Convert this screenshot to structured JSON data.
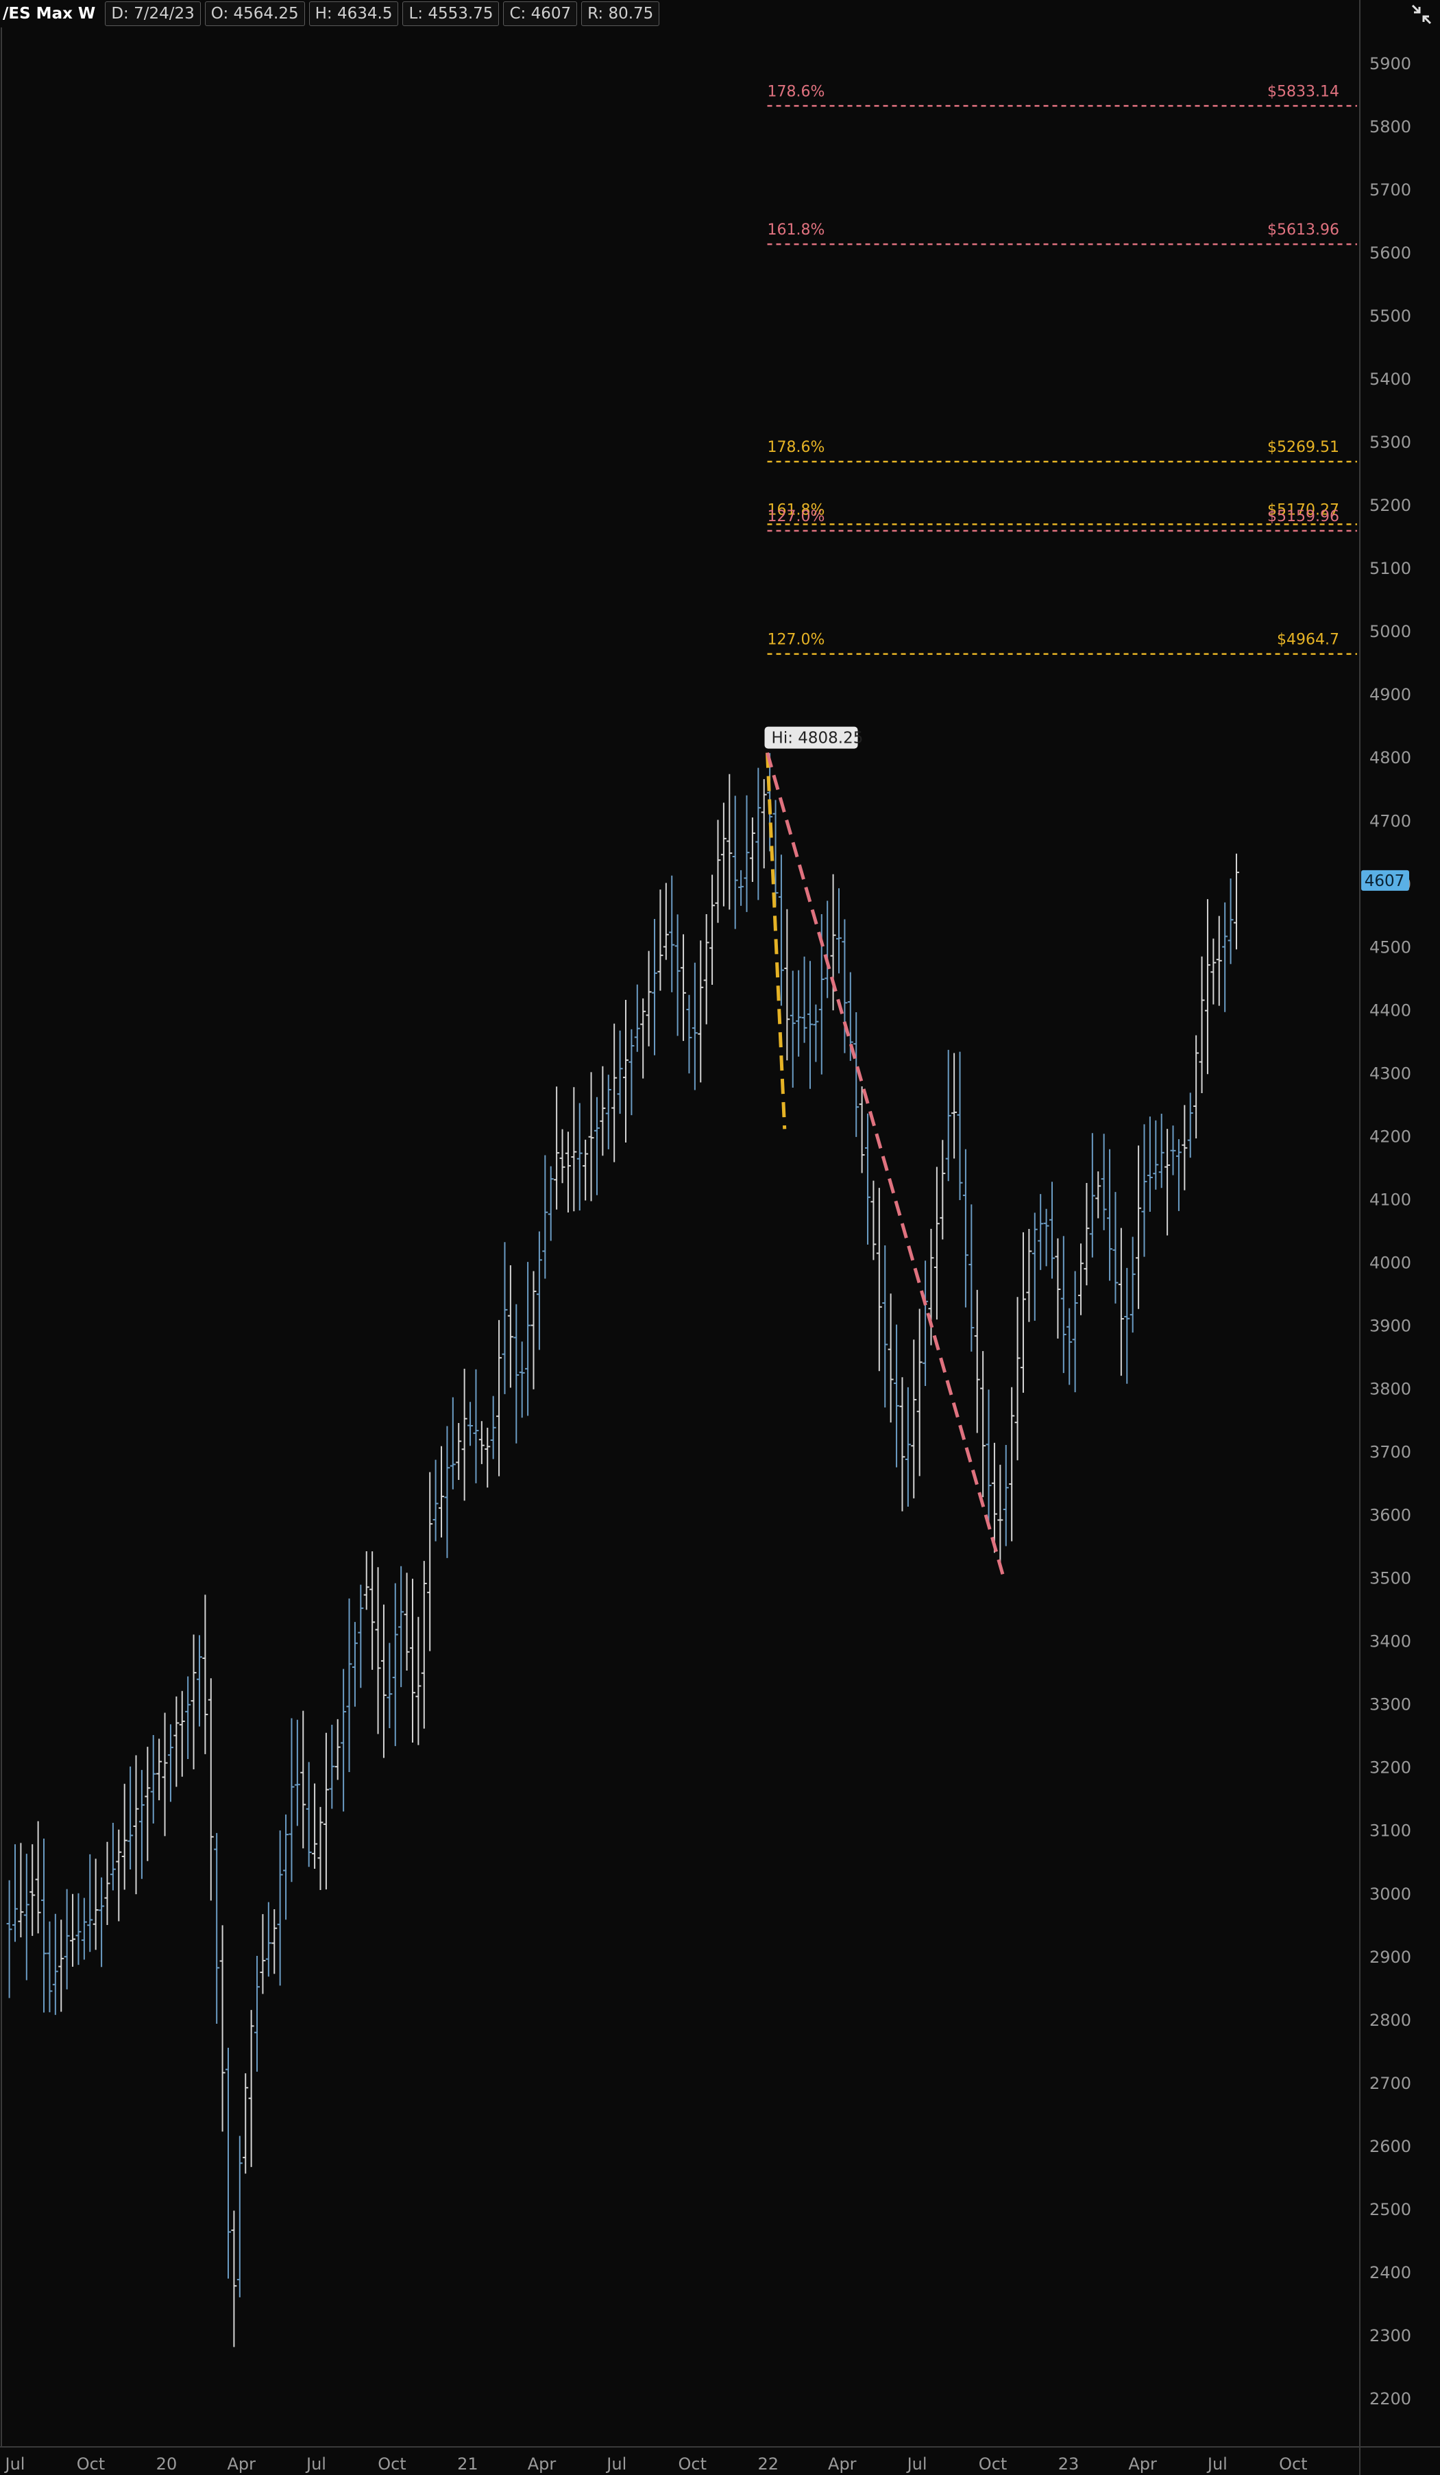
{
  "header": {
    "symbol": "/ES Max W",
    "date": "D: 7/24/23",
    "open": "O: 4564.25",
    "high": "H: 4634.5",
    "low": "L: 4553.75",
    "close": "C: 4607",
    "range": "R: 80.75"
  },
  "corner_icon": "collapse-arrows-icon",
  "colors": {
    "background": "#0a0a0a",
    "bar_light": "#d4d4d4",
    "bar_blue": "#6b9cc4",
    "fib_red": "#e0727f",
    "fib_gold": "#e6b325",
    "price_tag_bg": "#5ab0e6"
  },
  "chart_data": {
    "type": "ohlc",
    "title": "/ES Max W",
    "ylim": [
      2160,
      5980
    ],
    "y_ticks": [
      2200,
      2300,
      2400,
      2500,
      2600,
      2700,
      2800,
      2900,
      3000,
      3100,
      3200,
      3300,
      3400,
      3500,
      3600,
      3700,
      3800,
      3900,
      4000,
      4100,
      4200,
      4300,
      4400,
      4500,
      4600,
      4700,
      4800,
      4900,
      5000,
      5100,
      5200,
      5300,
      5400,
      5500,
      5600,
      5700,
      5800,
      5900
    ],
    "x_ticks": [
      {
        "label": "Jul",
        "date": "2019-07-01"
      },
      {
        "label": "Oct",
        "date": "2019-10-01"
      },
      {
        "label": "20",
        "date": "2020-01-01"
      },
      {
        "label": "Apr",
        "date": "2020-04-01"
      },
      {
        "label": "Jul",
        "date": "2020-07-01"
      },
      {
        "label": "Oct",
        "date": "2020-10-01"
      },
      {
        "label": "21",
        "date": "2021-01-01"
      },
      {
        "label": "Apr",
        "date": "2021-04-01"
      },
      {
        "label": "Jul",
        "date": "2021-07-01"
      },
      {
        "label": "Oct",
        "date": "2021-10-01"
      },
      {
        "label": "22",
        "date": "2022-01-01"
      },
      {
        "label": "Apr",
        "date": "2022-04-01"
      },
      {
        "label": "Jul",
        "date": "2022-07-01"
      },
      {
        "label": "Oct",
        "date": "2022-10-01"
      },
      {
        "label": "23",
        "date": "2023-01-01"
      },
      {
        "label": "Apr",
        "date": "2023-04-01"
      },
      {
        "label": "Jul",
        "date": "2023-07-01"
      },
      {
        "label": "Oct",
        "date": "2023-10-01"
      }
    ],
    "price_path": [
      [
        "2019-06-24",
        2950
      ],
      [
        "2019-07-26",
        3020
      ],
      [
        "2019-08-09",
        2850
      ],
      [
        "2019-08-30",
        2920
      ],
      [
        "2019-10-04",
        2960
      ],
      [
        "2019-11-01",
        3060
      ],
      [
        "2019-12-13",
        3170
      ],
      [
        "2020-01-24",
        3290
      ],
      [
        "2020-02-14",
        3390
      ],
      [
        "2020-02-28",
        2960
      ],
      [
        "2020-03-13",
        2640
      ],
      [
        "2020-03-20",
        2250
      ],
      [
        "2020-03-27",
        2540
      ],
      [
        "2020-04-17",
        2850
      ],
      [
        "2020-05-08",
        2930
      ],
      [
        "2020-06-05",
        3200
      ],
      [
        "2020-06-26",
        3050
      ],
      [
        "2020-07-31",
        3270
      ],
      [
        "2020-08-28",
        3500
      ],
      [
        "2020-09-25",
        3290
      ],
      [
        "2020-10-09",
        3470
      ],
      [
        "2020-10-30",
        3270
      ],
      [
        "2020-11-13",
        3580
      ],
      [
        "2020-12-31",
        3750
      ],
      [
        "2021-01-29",
        3700
      ],
      [
        "2021-02-12",
        3930
      ],
      [
        "2021-03-05",
        3810
      ],
      [
        "2021-04-16",
        4170
      ],
      [
        "2021-05-14",
        4160
      ],
      [
        "2021-06-25",
        4270
      ],
      [
        "2021-07-30",
        4390
      ],
      [
        "2021-08-27",
        4510
      ],
      [
        "2021-09-03",
        4530
      ],
      [
        "2021-10-01",
        4340
      ],
      [
        "2021-11-05",
        4690
      ],
      [
        "2021-11-26",
        4590
      ],
      [
        "2021-12-31",
        4770
      ],
      [
        "2022-01-21",
        4390
      ],
      [
        "2022-02-25",
        4380
      ],
      [
        "2022-03-25",
        4540
      ],
      [
        "2022-04-29",
        4130
      ],
      [
        "2022-05-20",
        3900
      ],
      [
        "2022-06-17",
        3670
      ],
      [
        "2022-07-29",
        4120
      ],
      [
        "2022-08-12",
        4290
      ],
      [
        "2022-09-02",
        3930
      ],
      [
        "2022-09-30",
        3590
      ],
      [
        "2022-10-14",
        3600
      ],
      [
        "2022-11-11",
        4000
      ],
      [
        "2022-12-02",
        4080
      ],
      [
        "2022-12-30",
        3860
      ],
      [
        "2023-02-03",
        4150
      ],
      [
        "2023-03-10",
        3870
      ],
      [
        "2023-03-31",
        4130
      ],
      [
        "2023-05-26",
        4200
      ],
      [
        "2023-06-16",
        4450
      ],
      [
        "2023-07-14",
        4520
      ],
      [
        "2023-07-24",
        4607
      ]
    ],
    "hi_label": "Hi: 4808.25",
    "hi_point": {
      "date": "2021-12-31",
      "price": 4808.25
    },
    "last_price_label": "4607",
    "last_price": 4607,
    "lines": [
      {
        "name": "gold",
        "from": {
          "date": "2021-12-31",
          "price": 4808.25
        },
        "to": {
          "date": "2022-01-21",
          "price": 4212
        }
      },
      {
        "name": "red",
        "from": {
          "date": "2021-12-31",
          "price": 4808.25
        },
        "to": {
          "date": "2022-10-14",
          "price": 3502
        }
      }
    ],
    "fib_levels": [
      {
        "pct_label": "178.6%",
        "price_label": "$5833.14",
        "price": 5833.14,
        "color": "red"
      },
      {
        "pct_label": "161.8%",
        "price_label": "$5613.96",
        "price": 5613.96,
        "color": "red"
      },
      {
        "pct_label": "178.6%",
        "price_label": "$5269.51",
        "price": 5269.51,
        "color": "gold"
      },
      {
        "pct_label": "161.8%",
        "price_label": "$5170.27",
        "price": 5170.27,
        "color": "gold"
      },
      {
        "pct_label": "127.0%",
        "price_label": "$5159.96",
        "price": 5159.96,
        "color": "red"
      },
      {
        "pct_label": "127.0%",
        "price_label": "$4964.7",
        "price": 4964.7,
        "color": "gold"
      }
    ],
    "fib_start_date": "2021-12-31"
  }
}
